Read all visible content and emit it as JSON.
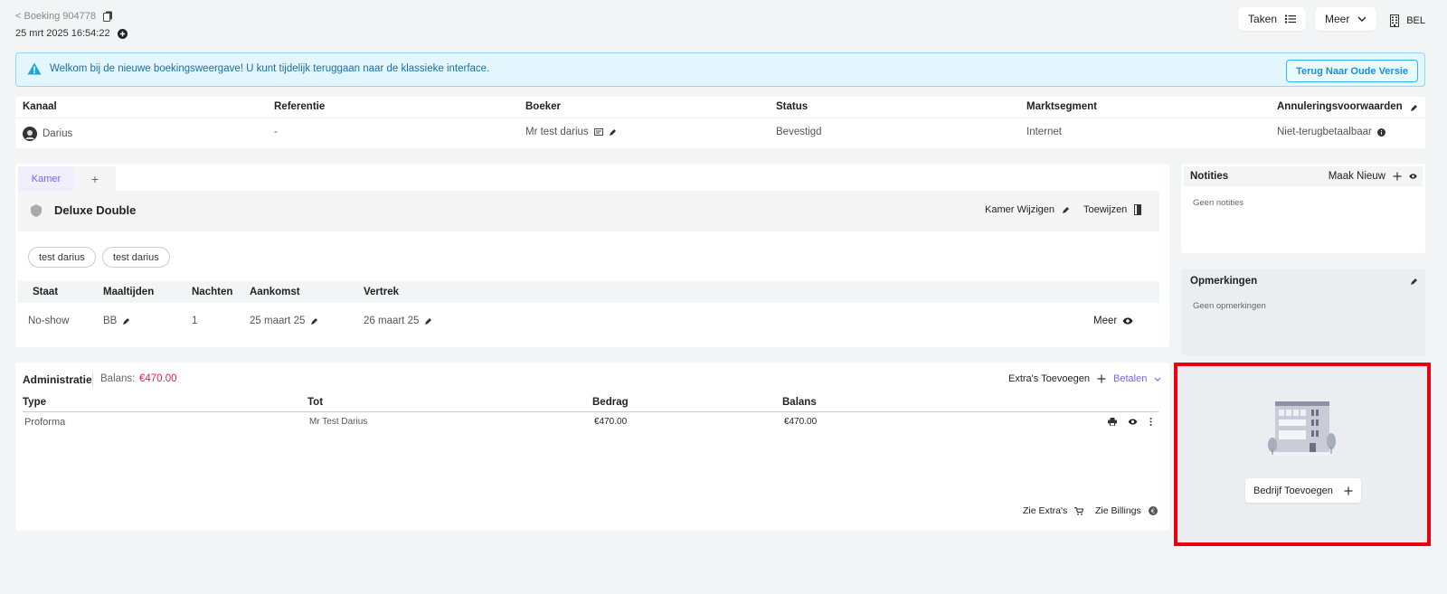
{
  "header": {
    "back_label": "< Boeking 904778",
    "timestamp": "25 mrt 2025 16:54:22",
    "tasks_label": "Taken",
    "more_label": "Meer",
    "hotel_label": "BEL"
  },
  "banner": {
    "message": "Welkom bij de nieuwe boekingsweergave! U kunt tijdelijk teruggaan naar de klassieke interface.",
    "button_label": "Terug Naar Oude Versie"
  },
  "summary": {
    "headers": [
      "Kanaal",
      "Referentie",
      "Boeker",
      "Status",
      "Marktsegment",
      "Annuleringsvoorwaarden"
    ],
    "values": [
      "Darius",
      "-",
      "Mr test darius",
      "Bevestigd",
      "Internet",
      "Niet-terugbetaalbaar"
    ]
  },
  "room": {
    "tab_label": "Kamer",
    "tab_add": "+",
    "name": "Deluxe Double",
    "change_label": "Kamer Wijzigen",
    "assign_label": "Toewijzen",
    "guests": [
      "test darius",
      "test darius"
    ],
    "stay_headers": [
      "Staat",
      "Maaltijden",
      "Nachten",
      "Aankomst",
      "Vertrek"
    ],
    "stay_values": [
      "No-show",
      "BB",
      "1",
      "25 maart 25",
      "26 maart 25"
    ],
    "more_label": "Meer"
  },
  "admin": {
    "title": "Administratie",
    "balance_label": "Balans:",
    "balance_value": "€470.00",
    "extras_label": "Extra's Toevoegen",
    "pay_label": "Betalen",
    "headers": [
      "Type",
      "Tot",
      "Bedrag",
      "Balans"
    ],
    "rows": [
      {
        "type": "Proforma",
        "to": "Mr Test Darius",
        "amount": "€470.00",
        "balance": "€470.00"
      }
    ],
    "see_extras": "Zie Extra's",
    "see_billings": "Zie Billings"
  },
  "notes": {
    "title": "Notities",
    "new_label": "Maak Nieuw",
    "empty": "Geen notities"
  },
  "remarks": {
    "title": "Opmerkingen",
    "empty": "Geen opmerkingen"
  },
  "company": {
    "button_label": "Bedrijf Toevoegen"
  },
  "colors": {
    "accent": "#7b61ff",
    "balance": "#e01f4f",
    "banner_bg": "#e3f6fd",
    "banner_text": "#1b6ea0",
    "highlight_border": "#e8000e"
  }
}
